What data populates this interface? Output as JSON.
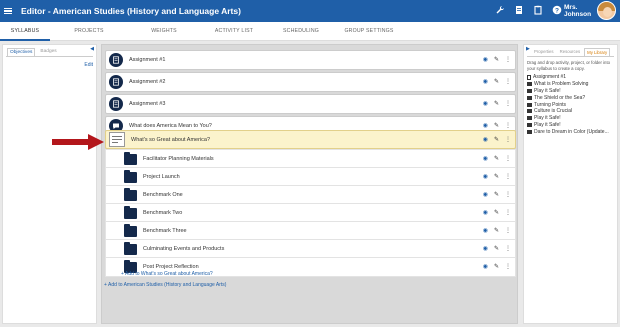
{
  "header": {
    "title": "Editor - American Studies (History and Language Arts)",
    "user_name": "Mrs. Johnson",
    "icons": [
      "wrench-icon",
      "document-icon",
      "clipboard-icon",
      "help-icon"
    ]
  },
  "tabs": [
    {
      "label": "SYLLABUS",
      "active": true
    },
    {
      "label": "PROJECTS",
      "active": false
    },
    {
      "label": "WEIGHTS",
      "active": false
    },
    {
      "label": "ACTIVITY LIST",
      "active": false
    },
    {
      "label": "SCHEDULING",
      "active": false
    },
    {
      "label": "GROUP SETTINGS",
      "active": false
    }
  ],
  "left_panel": {
    "tabs": [
      "Objectives",
      "Badges"
    ],
    "edit_label": "Edit"
  },
  "syllabus": {
    "items": [
      {
        "label": "Assignment #1",
        "icon": "assignment-icon"
      },
      {
        "label": "Assignment #2",
        "icon": "assignment-icon"
      },
      {
        "label": "Assignment #3",
        "icon": "assignment-icon"
      },
      {
        "label": "What does America Mean to You?",
        "icon": "discussion-icon"
      },
      {
        "label": "What's so Great about America?",
        "icon": "project-thumbnail",
        "highlighted": true
      }
    ],
    "children": [
      {
        "label": "Facilitator Planning Materials"
      },
      {
        "label": "Project Launch"
      },
      {
        "label": "Benchmark One"
      },
      {
        "label": "Benchmark Two"
      },
      {
        "label": "Benchmark Three"
      },
      {
        "label": "Culminating Events and Products"
      },
      {
        "label": "Post Project Reflection"
      }
    ],
    "add_child_label": "+ Add to What's so Great about America?",
    "add_main_label": "+ Add to American Studies (History and Language Arts)"
  },
  "right_panel": {
    "tabs": [
      {
        "label": "Properties",
        "active": false
      },
      {
        "label": "Resources",
        "active": false
      },
      {
        "label": "My Library",
        "active": true
      }
    ],
    "hint": "Drag and drop activity, project, or folder into your syllabus to create a copy.",
    "library": [
      {
        "label": "Assignment #1",
        "type": "doc"
      },
      {
        "label": "What is Problem Solving",
        "type": "folder"
      },
      {
        "label": "Play it Safe!",
        "type": "folder"
      },
      {
        "label": "The Shield or the Sea?",
        "type": "folder"
      },
      {
        "label": "Turning Points",
        "type": "folder"
      },
      {
        "label": "Culture is Crucial",
        "type": "folder"
      },
      {
        "label": "Play it Safe!",
        "type": "folder"
      },
      {
        "label": "Play it Safe!",
        "type": "folder"
      },
      {
        "label": "Dare to Dream in Color (Update...",
        "type": "folder"
      }
    ]
  },
  "colors": {
    "brand": "#1f5fa8",
    "icon_dark": "#14294b",
    "highlight": "#fbf3cc",
    "annotation_arrow": "#b3161b",
    "library_active_tab": "#d67a00"
  }
}
